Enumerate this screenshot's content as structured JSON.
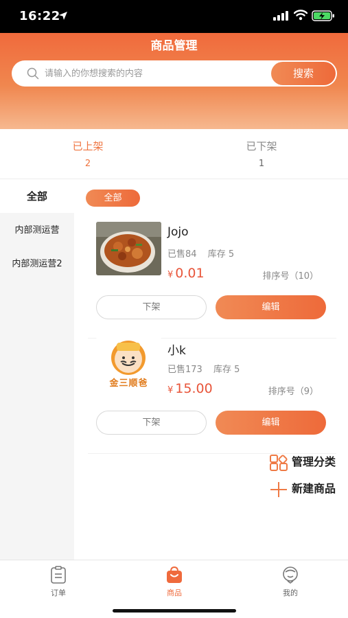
{
  "status_bar": {
    "time": "16:22"
  },
  "header": {
    "title": "商品管理",
    "search": {
      "placeholder": "请输入的你想搜索的内容",
      "value": "",
      "button_label": "搜索"
    }
  },
  "tabs": [
    {
      "label": "已上架",
      "count": "2",
      "active": true
    },
    {
      "label": "已下架",
      "count": "1",
      "active": false
    }
  ],
  "sidebar": {
    "items": [
      {
        "label": "全部",
        "active": true
      },
      {
        "label": "内部测运营",
        "active": false
      },
      {
        "label": "内部测运营2",
        "active": false
      }
    ]
  },
  "filter_chip": {
    "label": "全部"
  },
  "products": [
    {
      "name": "Jojo",
      "sold": "已售84",
      "stock": "库存 5",
      "currency": "¥",
      "price": "0.01",
      "sort": "排序号（10）",
      "off_shelf_label": "下架",
      "edit_label": "编辑",
      "image_icon": "food-dish-photo"
    },
    {
      "name": "小k",
      "sold": "已售173",
      "stock": "库存 5",
      "currency": "¥",
      "price": "15.00",
      "sort": "排序号（9）",
      "off_shelf_label": "下架",
      "edit_label": "编辑",
      "image_icon": "chef-logo",
      "logo_text": "金三顺爸"
    }
  ],
  "actions": {
    "manage_category": "管理分类",
    "new_product": "新建商品"
  },
  "tabbar": [
    {
      "label": "订单",
      "icon": "clipboard-icon",
      "active": false
    },
    {
      "label": "商品",
      "icon": "shopping-bag-icon",
      "active": true
    },
    {
      "label": "我的",
      "icon": "profile-icon",
      "active": false
    }
  ],
  "colors": {
    "accent": "#ef6a3c",
    "price": "#e8553a",
    "header_top": "#f06a3c",
    "header_bottom": "#f6b88f",
    "battery_green": "#4cd964"
  }
}
